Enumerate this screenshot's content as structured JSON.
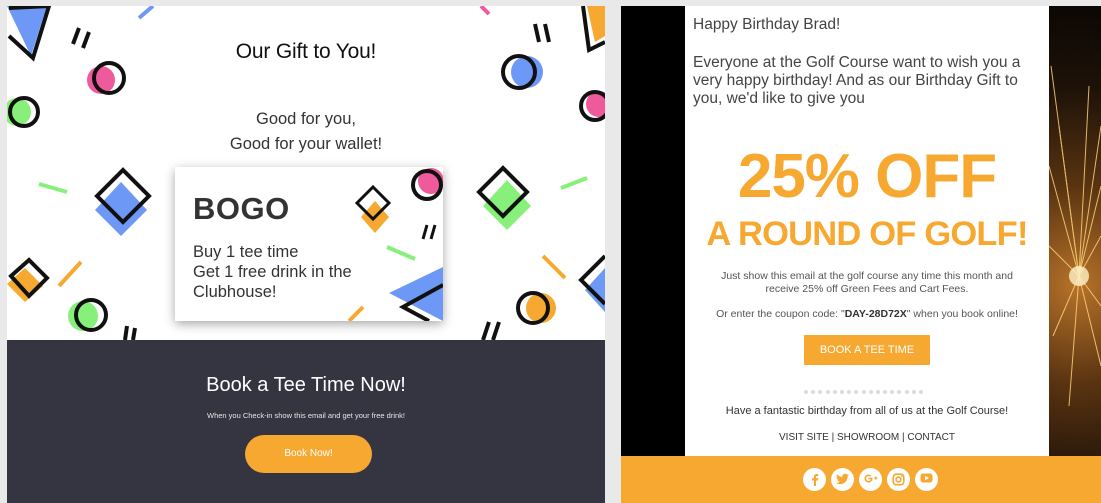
{
  "left_email": {
    "title": "Our Gift to You!",
    "subtitle_lines": [
      "Good for you,",
      "Good for your wallet!"
    ],
    "card": {
      "title": "BOGO",
      "lines": [
        "Buy 1 tee time",
        "Get 1 free drink in the",
        "Clubhouse!"
      ]
    },
    "footer": {
      "title": "Book a Tee Time Now!",
      "small_text": "When you Check-in show this email and get your free drink!",
      "button_label": "Book Now!"
    }
  },
  "right_email": {
    "greeting": "Happy Birthday Brad!",
    "intro": "Everyone at the Golf Course want to wish you a very happy birthday! And as our Birthday Gift to you, we'd like to give you",
    "offer_big": "25% OFF",
    "offer_sub": "A ROUND OF GOLF!",
    "show_email_text": "Just show this email at the golf course any time this month and receive 25% off Green Fees and Cart Fees.",
    "coupon_prefix": "Or enter the coupon code: \"",
    "coupon_code": "DAY-28D72X",
    "coupon_suffix": "\" when you book online!",
    "button_label": "BOOK A TEE TIME",
    "closing": "Have a fantastic birthday from all of us at the Golf Course!",
    "links": [
      "VISIT SITE",
      "SHOWROOM",
      "CONTACT"
    ],
    "link_separator": " | ",
    "socials": [
      "facebook-icon",
      "twitter-icon",
      "google-plus-icon",
      "instagram-icon",
      "youtube-icon"
    ]
  },
  "colors": {
    "accent_orange": "#f7a830",
    "dark_navy": "#353541",
    "shape_blue": "#6e98f5",
    "shape_pink": "#ef5a9d",
    "shape_green": "#86f07a"
  }
}
